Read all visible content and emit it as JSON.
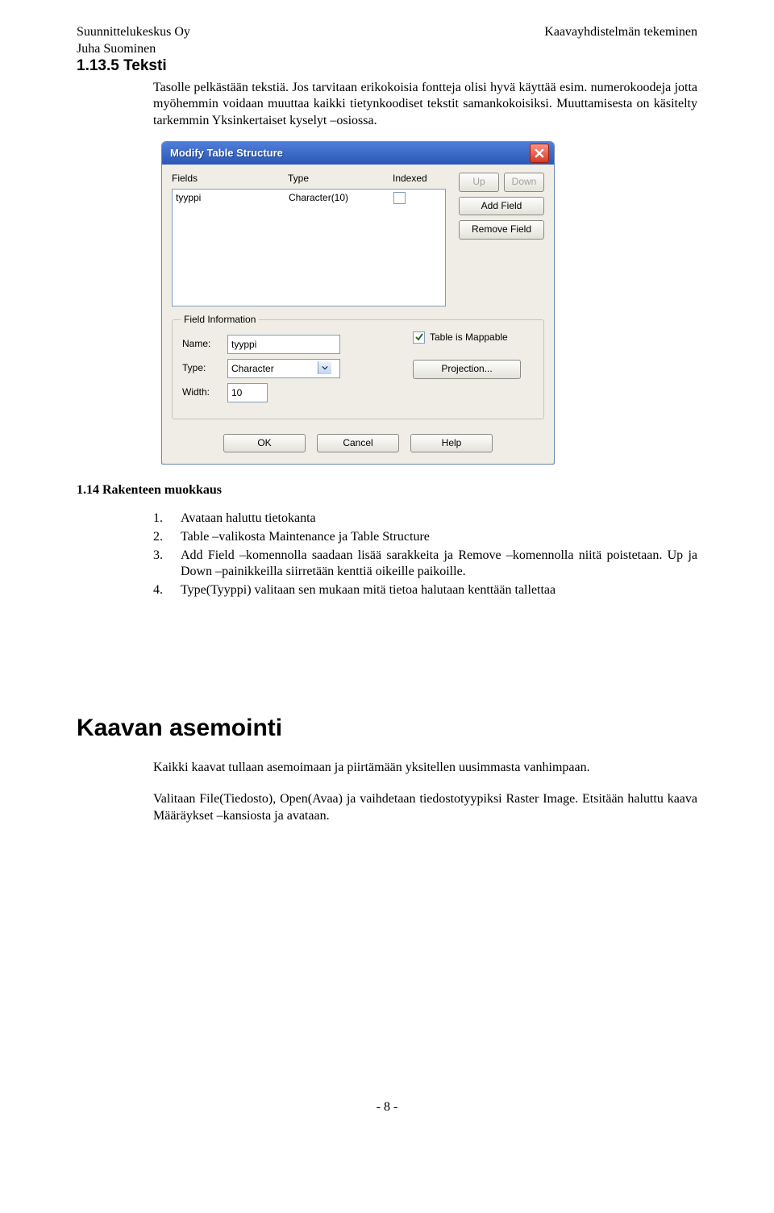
{
  "header": {
    "left1": "Suunnittelukeskus Oy",
    "left2": "Juha Suominen",
    "right": "Kaavayhdistelmän tekeminen"
  },
  "sect_title": "1.13.5 Teksti",
  "p1": "Tasolle pelkästään tekstiä. Jos tarvitaan erikokoisia fontteja olisi hyvä käyttää esim. numerokoodeja jotta myöhemmin voidaan muuttaa kaikki tietynkoodiset tekstit samankokoisiksi. Muuttamisesta on käsitelty tarkemmin Yksinkertaiset kyselyt –osiossa.",
  "dialog": {
    "title": "Modify Table Structure",
    "headers": {
      "fields": "Fields",
      "type": "Type",
      "indexed": "Indexed"
    },
    "row": {
      "name": "tyyppi",
      "type": "Character(10)"
    },
    "btn": {
      "up": "Up",
      "down": "Down",
      "add": "Add Field",
      "remove": "Remove Field",
      "ok": "OK",
      "cancel": "Cancel",
      "help": "Help",
      "proj": "Projection..."
    },
    "group": "Field Information",
    "lbl": {
      "name": "Name:",
      "type": "Type:",
      "width": "Width:"
    },
    "val": {
      "name": "tyyppi",
      "type": "Character",
      "width": "10"
    },
    "mappable": "Table is Mappable"
  },
  "caption": "1.14 Rakenteen muokkaus",
  "steps": [
    "Avataan haluttu tietokanta",
    "Table –valikosta Maintenance ja Table Structure",
    "Add Field –komennolla saadaan lisää sarakkeita ja Remove –komennolla niitä poistetaan. Up ja Down –painikkeilla siirretään kenttiä oikeille paikoille.",
    "Type(Tyyppi) valitaan sen mukaan mitä tietoa halutaan kenttään tallettaa"
  ],
  "big_title": "Kaavan asemointi",
  "p2": "Kaikki kaavat tullaan asemoimaan ja piirtämään yksitellen uusimmasta vanhimpaan.",
  "p3": "Valitaan File(Tiedosto), Open(Avaa) ja vaihdetaan tiedostotyypiksi Raster Image. Etsitään haluttu kaava Määräykset –kansiosta ja avataan.",
  "pagenum": "- 8 -"
}
